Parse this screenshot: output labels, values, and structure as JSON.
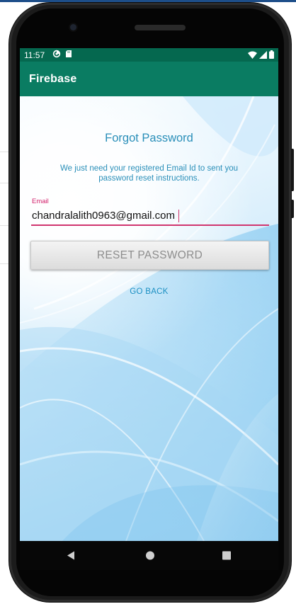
{
  "status_bar": {
    "time": "11:57",
    "left_icons": [
      "sync-icon",
      "sd-card-icon"
    ],
    "right_icons": [
      "wifi-icon",
      "cell-signal-icon",
      "battery-icon"
    ]
  },
  "app_bar": {
    "title": "Firebase"
  },
  "form": {
    "heading": "Forgot Password",
    "description": "We just need your registered Email Id to sent you password reset instructions.",
    "email_label": "Email",
    "email_value": "chandralalith0963@gmail.com",
    "reset_button": "RESET PASSWORD",
    "go_back": "GO BACK"
  },
  "nav_bar": {
    "icons": [
      "back-icon",
      "home-icon",
      "recents-icon"
    ]
  },
  "colors": {
    "status_bar": "#05684f",
    "app_bar": "#0a7c62",
    "accent_text": "#2a8fb9",
    "input_accent": "#d0356f"
  }
}
